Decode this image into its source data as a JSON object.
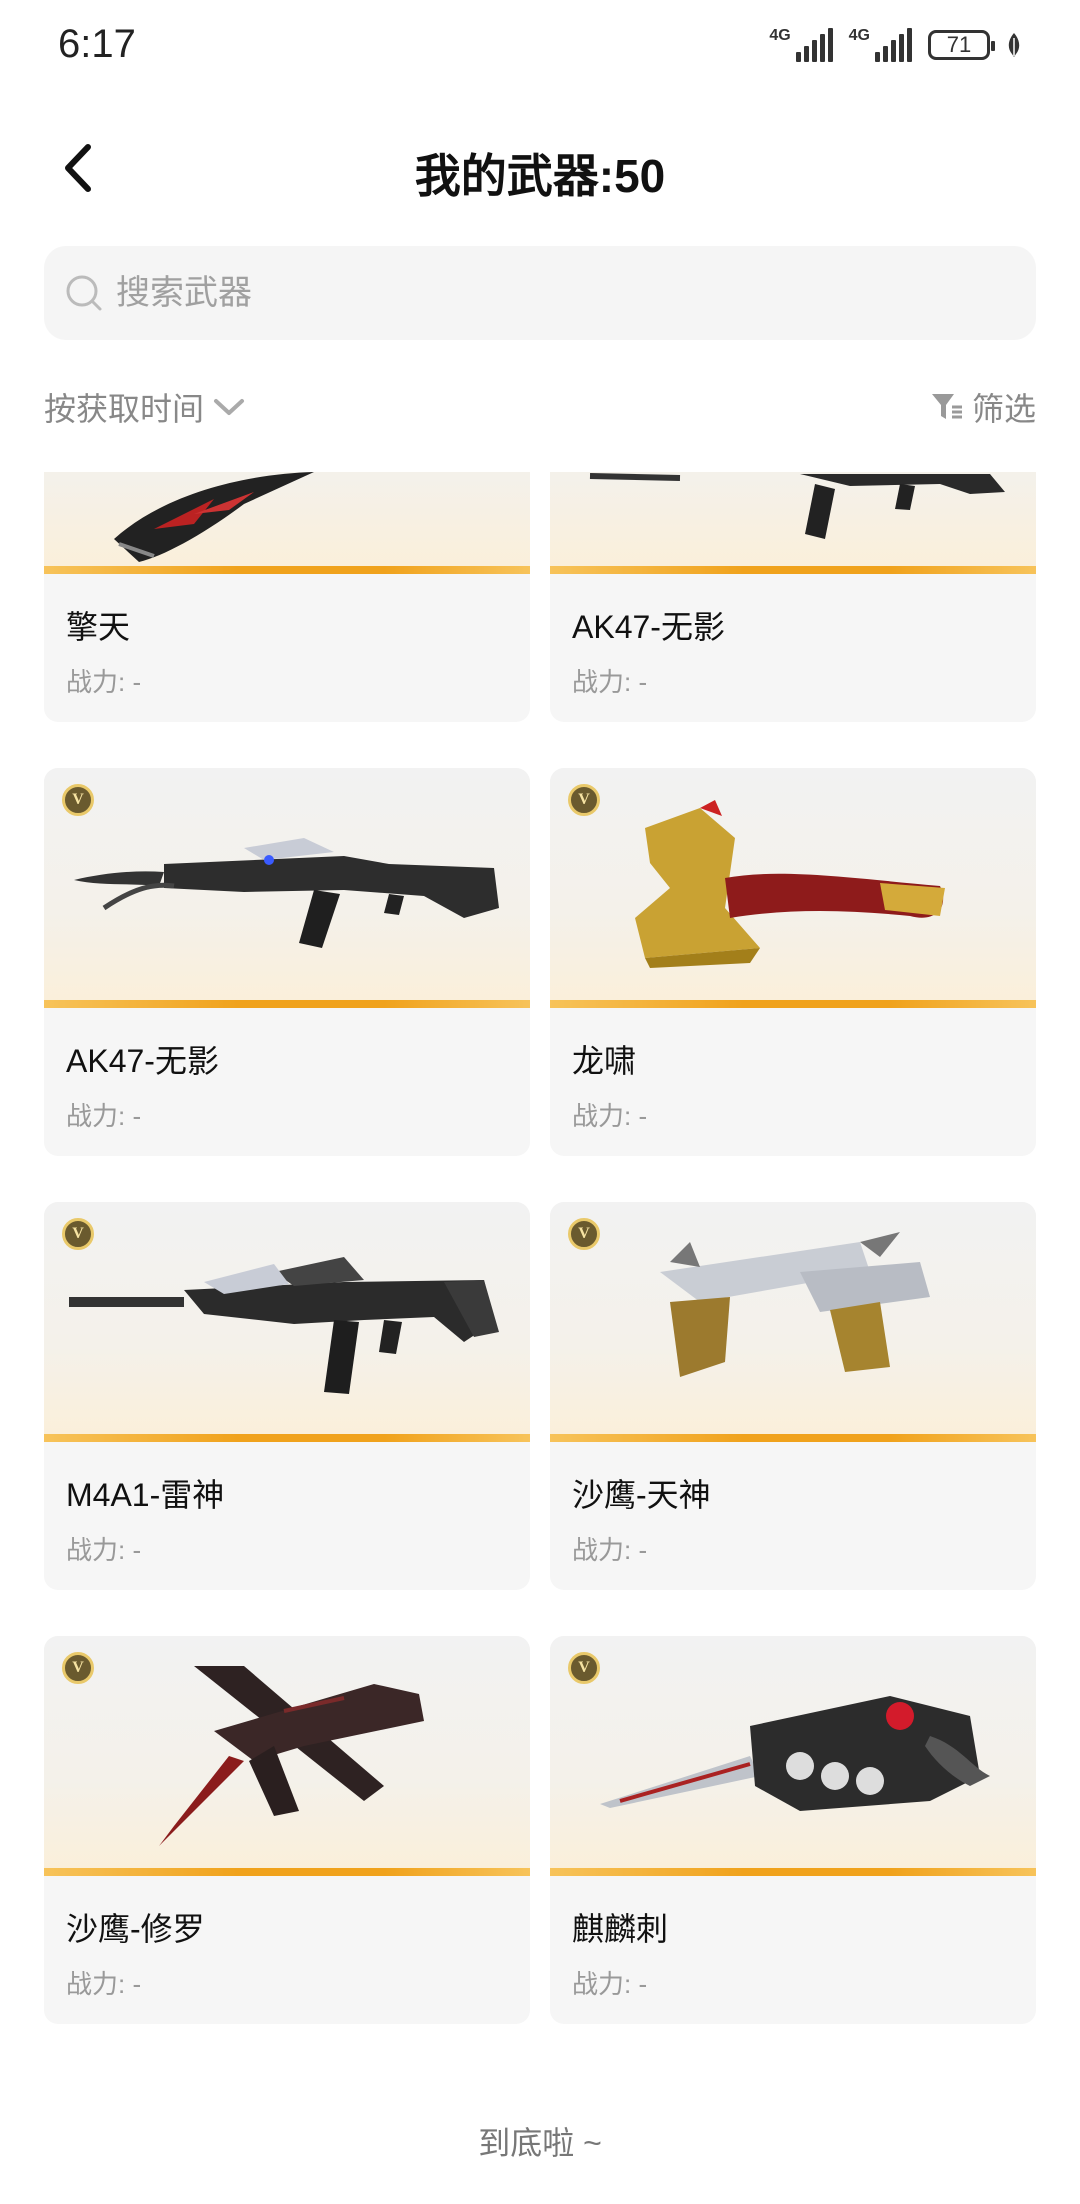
{
  "status_bar": {
    "time": "6:17",
    "network_1": "4G",
    "network_2": "4G",
    "battery": "71",
    "icons": [
      "signal-icon",
      "signal-icon",
      "battery-icon",
      "leaf-icon"
    ]
  },
  "header": {
    "title": "我的武器:50",
    "back_icon": "chevron-left-icon"
  },
  "search": {
    "placeholder": "搜索武器",
    "value": ""
  },
  "sort": {
    "label": "按获取时间",
    "icon": "chevron-down-icon"
  },
  "filter": {
    "label": "筛选",
    "icon": "funnel-icon"
  },
  "weapons": [
    {
      "name": "擎天",
      "power": "战力: -",
      "badge": "",
      "image": "blade-weapon"
    },
    {
      "name": "AK47-无影",
      "power": "战力: -",
      "badge": "",
      "image": "rifle-weapon"
    },
    {
      "name": "AK47-无影",
      "power": "战力: -",
      "badge": "V",
      "image": "ak47-weapon"
    },
    {
      "name": "龙啸",
      "power": "战力: -",
      "badge": "V",
      "image": "dragon-axe-weapon"
    },
    {
      "name": "M4A1-雷神",
      "power": "战力: -",
      "badge": "V",
      "image": "m4a1-weapon"
    },
    {
      "name": "沙鹰-天神",
      "power": "战力: -",
      "badge": "V",
      "image": "dual-pistol-weapon"
    },
    {
      "name": "沙鹰-修罗",
      "power": "战力: -",
      "badge": "V",
      "image": "pistol-knife-weapon"
    },
    {
      "name": "麒麟刺",
      "power": "战力: -",
      "badge": "V",
      "image": "knuckle-knife-weapon"
    }
  ],
  "footer": {
    "end_text": "到底啦 ~"
  },
  "colors": {
    "accent_orange": "#f0a21c",
    "card_bg": "#f6f6f6",
    "muted_text": "#999999"
  }
}
